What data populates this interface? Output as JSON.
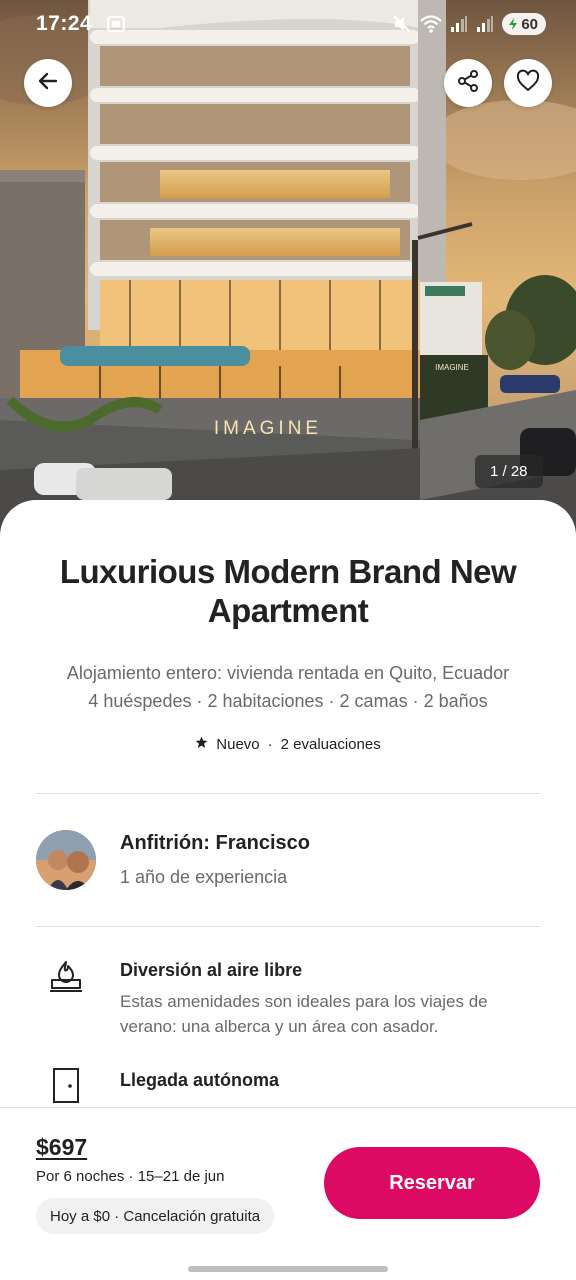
{
  "status_bar": {
    "time": "17:24",
    "battery": "60",
    "icons": [
      "screenshot-icon",
      "mute-icon",
      "wifi-icon",
      "signal-icon",
      "signal-icon",
      "battery-icon"
    ]
  },
  "gallery": {
    "counter": "1 / 28",
    "sign_text": "IMAGINE",
    "small_sign_text": "IMAGINE",
    "icons": {
      "back": "arrow-left-icon",
      "share": "share-icon",
      "favorite": "heart-icon"
    }
  },
  "listing": {
    "title": "Luxurious Modern Brand New Apartment",
    "subtitle_line1": "Alojamiento entero: vivienda rentada en Quito, Ecuador",
    "subtitle_line2": "4 huéspedes · 2 habitaciones · 2 camas · 2 baños",
    "rating_label": "Nuevo",
    "rating_separator": "·",
    "reviews": "2 evaluaciones"
  },
  "host": {
    "name": "Anfitrión: Francisco",
    "experience": "1 año de experiencia"
  },
  "features": [
    {
      "icon": "fire-pit-icon",
      "title": "Diversión al aire libre",
      "description": "Estas amenidades son ideales para los viajes de verano: una alberca y un área con asador."
    },
    {
      "icon": "door-icon",
      "title": "Llegada autónoma"
    }
  ],
  "booking": {
    "price": "$697",
    "detail": "Por 6 noches · 15–21 de jun",
    "pill": "Hoy a $0 · Cancelación gratuita",
    "reserve_label": "Reservar",
    "accent_color": "#dd0a63"
  }
}
